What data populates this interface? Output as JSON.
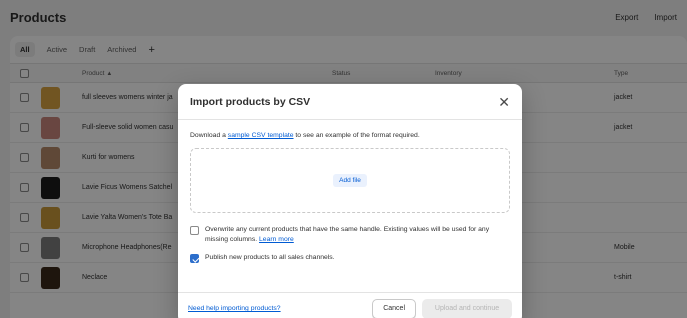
{
  "header": {
    "title": "Products",
    "actions": [
      "Export",
      "Import"
    ]
  },
  "tabs": [
    "All",
    "Active",
    "Draft",
    "Archived",
    "+"
  ],
  "table": {
    "columns": {
      "product": "Product",
      "status": "Status",
      "inventory": "Inventory",
      "type": "Type"
    },
    "rows": [
      {
        "name": "full sleeves womens winter ja",
        "type": "jacket",
        "thumb_color": "#d9a441"
      },
      {
        "name": "Full-sleeve solid women casu",
        "type": "jacket",
        "thumb_color": "#c9867e"
      },
      {
        "name": "Kurti for womens",
        "type": "",
        "thumb_color": "#b78a6a"
      },
      {
        "name": "Lavie Ficus Womens Satchel",
        "type": "",
        "thumb_color": "#1c1c1c"
      },
      {
        "name": "Lavie Yalta Women's Tote Ba",
        "type": "",
        "thumb_color": "#c99a3b"
      },
      {
        "name": "Microphone Headphones(Re",
        "type": "Mobile",
        "thumb_color": "#7d7d7d"
      },
      {
        "name": "Neclace",
        "type": "t-shirt",
        "thumb_color": "#3b2a1a"
      }
    ]
  },
  "modal": {
    "title": "Import products by CSV",
    "close_icon": "close-icon",
    "desc_before": "Download a ",
    "desc_link": "sample CSV template",
    "desc_after": " to see an example of the format required.",
    "add_file": "Add file",
    "overwrite_text": "Overwrite any current products that have the same handle. Existing values will be used for any missing columns. ",
    "overwrite_link": "Learn more",
    "overwrite_checked": false,
    "publish_text": "Publish new products to all sales channels.",
    "publish_checked": true,
    "help_link": "Need help importing products?",
    "cancel": "Cancel",
    "upload": "Upload and continue"
  },
  "colors": {
    "accent": "#005bd3",
    "checkbox_checked": "#2c6ecb",
    "overlay": "rgba(0,0,0,0.48)"
  }
}
